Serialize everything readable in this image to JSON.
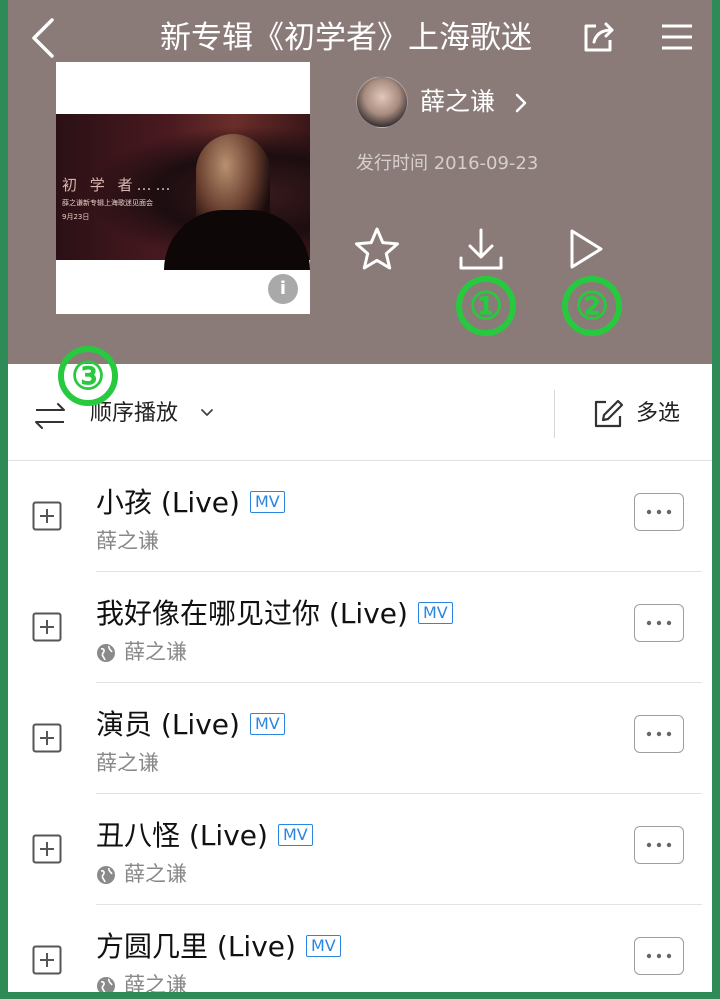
{
  "header": {
    "title": "新专辑《初学者》上海歌迷",
    "artist": "薛之谦",
    "release_label": "发行时间 2016-09-23",
    "background": "#8a7b79"
  },
  "cover": {
    "big_text": "初 学 者……",
    "small_text": "薛之谦新专辑上海歌迷见面会",
    "date_text": "9月23日"
  },
  "markers": [
    "①",
    "②",
    "③"
  ],
  "toolbar": {
    "order_label": "顺序播放",
    "multi_label": "多选"
  },
  "songs": [
    {
      "title": "小孩 (Live)",
      "badge": "MV",
      "artist": "薛之谦",
      "globe": false
    },
    {
      "title": "我好像在哪见过你 (Live)",
      "badge": "MV",
      "artist": "薛之谦",
      "globe": true
    },
    {
      "title": "演员 (Live)",
      "badge": "MV",
      "artist": "薛之谦",
      "globe": false
    },
    {
      "title": "丑八怪 (Live)",
      "badge": "MV",
      "artist": "薛之谦",
      "globe": true
    },
    {
      "title": "方圆几里 (Live)",
      "badge": "MV",
      "artist": "薛之谦",
      "globe": true
    }
  ],
  "colors": {
    "accent": "#2a86e0",
    "marker": "#27c93f",
    "frame": "#2e8b57"
  }
}
